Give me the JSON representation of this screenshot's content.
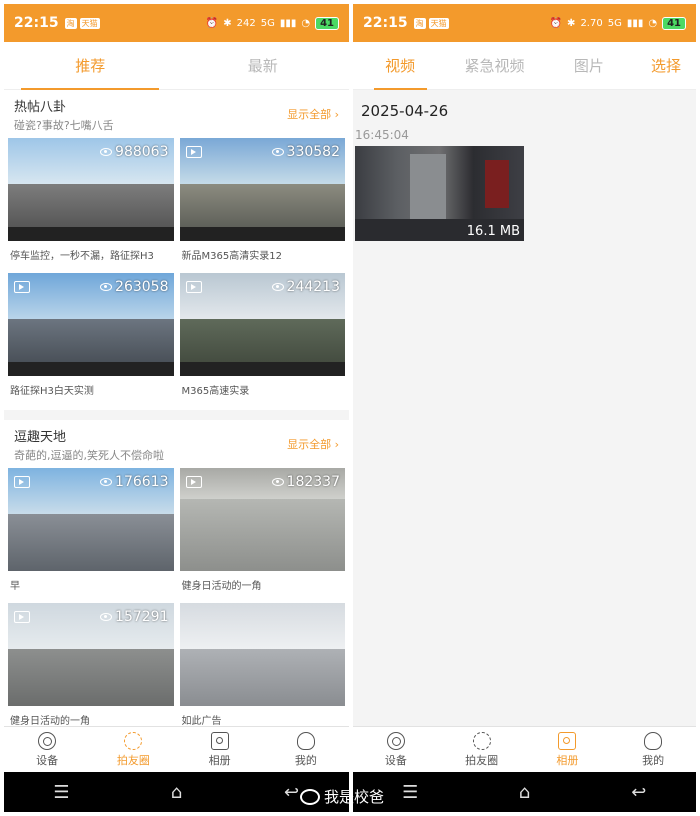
{
  "colors": {
    "accent": "#f39a2c",
    "statusbar": "#f39a2c",
    "background": "#f4f4f4"
  },
  "status_bar": {
    "time": "22:15",
    "badges": [
      "淘",
      "天猫"
    ],
    "left_speed": "242",
    "right_speed": "2.70",
    "network": [
      "5G",
      "5G"
    ],
    "battery": "41"
  },
  "left": {
    "tabs": [
      {
        "label": "推荐",
        "active": true
      },
      {
        "label": "最新",
        "active": false
      }
    ],
    "sections": [
      {
        "title": "热帖八卦",
        "subtitle": "碰瓷?事故?七嘴八舌",
        "show_all": "显示全部",
        "items": [
          {
            "views": "988063",
            "caption": "停车监控，一秒不漏，路征探H3",
            "icon": "eye-icon"
          },
          {
            "views": "330582",
            "caption": "新品M365高清实录12",
            "icon": "video-icon"
          },
          {
            "views": "263058",
            "caption": "路征探H3白天实测",
            "icon": "video-icon"
          },
          {
            "views": "244213",
            "caption": "M365高速实录",
            "icon": "video-icon"
          }
        ]
      },
      {
        "title": "逗趣天地",
        "subtitle": "奇葩的,逗逼的,笑死人不偿命啦",
        "show_all": "显示全部",
        "items": [
          {
            "views": "176613",
            "caption": "早",
            "icon": "video-icon"
          },
          {
            "views": "182337",
            "caption": "健身日活动的一角",
            "icon": "video-icon"
          },
          {
            "views": "157291",
            "caption": "健身日活动的一角",
            "icon": "video-icon"
          },
          {
            "views": "",
            "caption": "如此广告",
            "icon": "video-icon"
          }
        ]
      }
    ],
    "nav": [
      {
        "label": "设备",
        "active": false
      },
      {
        "label": "拍友圈",
        "active": true
      },
      {
        "label": "相册",
        "active": false
      },
      {
        "label": "我的",
        "active": false
      }
    ]
  },
  "right": {
    "tabs": [
      {
        "label": "视频",
        "active": true
      },
      {
        "label": "紧急视频",
        "active": false
      },
      {
        "label": "图片",
        "active": false
      }
    ],
    "select": "选择",
    "date": "2025-04-26",
    "time": "16:45:04",
    "file_size": "16.1 MB",
    "nav": [
      {
        "label": "设备",
        "active": false
      },
      {
        "label": "拍友圈",
        "active": false
      },
      {
        "label": "相册",
        "active": true
      },
      {
        "label": "我的",
        "active": false
      }
    ]
  },
  "system_nav": {
    "menu": "☰",
    "home": "⌂",
    "back": "↩"
  },
  "watermark": "我是校爸"
}
